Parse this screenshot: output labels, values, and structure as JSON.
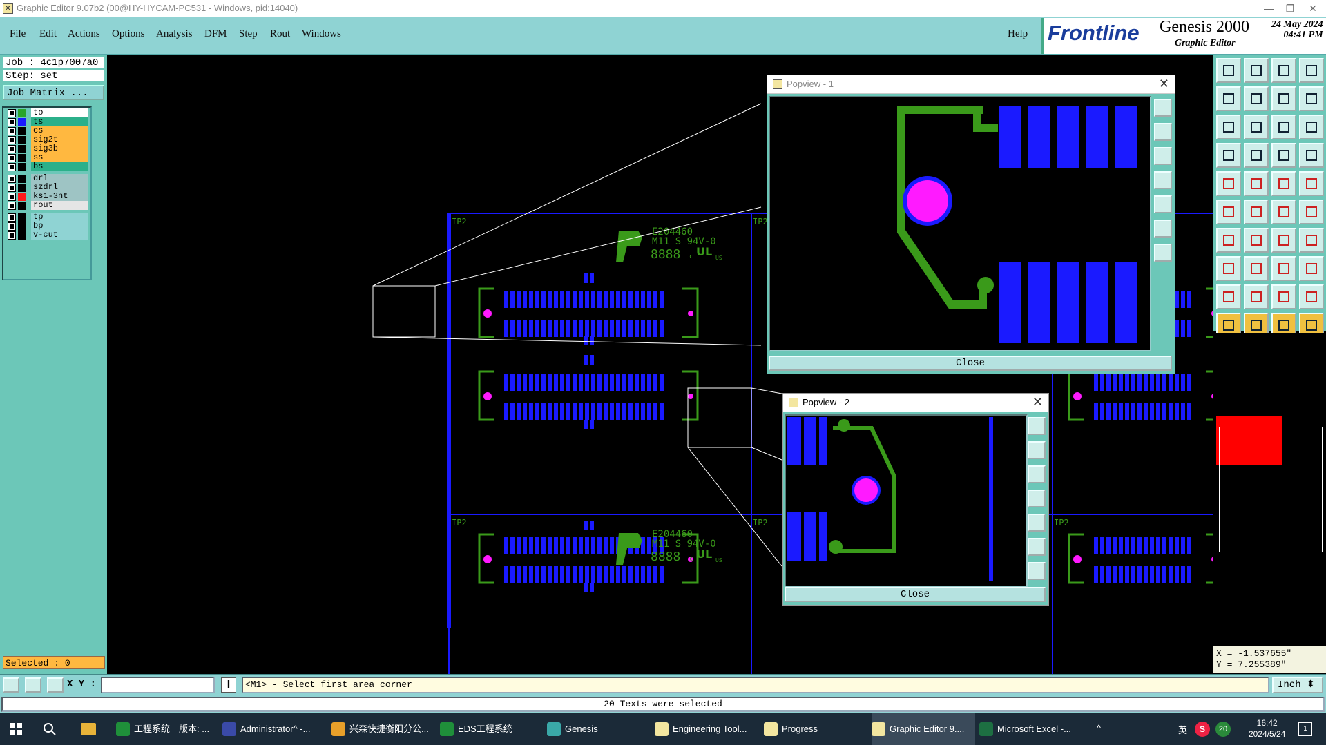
{
  "window": {
    "title": "Graphic Editor 9.07b2 (00@HY-HYCAM-PC531 - Windows, pid:14040)",
    "icon": "app-icon",
    "minimize": "—",
    "restore": "❐",
    "close": "✕"
  },
  "menu": {
    "items": [
      "File",
      "Edit",
      "Actions",
      "Options",
      "Analysis",
      "DFM",
      "Step",
      "Rout",
      "Windows"
    ],
    "help": "Help"
  },
  "branding": {
    "logo": "Frontline",
    "product": "Genesis 2000",
    "subtitle": "Graphic Editor",
    "date": "24 May 2024",
    "time": "04:41 PM"
  },
  "job": {
    "job_label": "Job : 4c1p7007a0",
    "step_label": "Step: set",
    "matrix_button": "Job Matrix ..."
  },
  "layers": [
    {
      "name": "to",
      "swatch": "#2aa52a",
      "bg": "#ffffff"
    },
    {
      "name": "ts",
      "swatch": "#1a1aff",
      "bg": "#2bb08a"
    },
    {
      "name": "cs",
      "swatch": "#000000",
      "bg": "#ffb840"
    },
    {
      "name": "sig2t",
      "swatch": "#000000",
      "bg": "#ffb840"
    },
    {
      "name": "sig3b",
      "swatch": "#000000",
      "bg": "#ffb840"
    },
    {
      "name": "ss",
      "swatch": "#000000",
      "bg": "#ffb840"
    },
    {
      "name": "bs",
      "swatch": "#000000",
      "bg": "#2bb08a"
    },
    {
      "name": "drl",
      "swatch": "#000000",
      "bg": "#9ec4c4"
    },
    {
      "name": "szdrl",
      "swatch": "#000000",
      "bg": "#9ec4c4"
    },
    {
      "name": "ks1-3nt",
      "swatch": "#ff1a1a",
      "bg": "#9ec4c4"
    },
    {
      "name": "rout",
      "swatch": "#000000",
      "bg": "#e5e5e5"
    },
    {
      "name": "tp",
      "swatch": "#000000",
      "bg": "#8fd3d3"
    },
    {
      "name": "bp",
      "swatch": "#000000",
      "bg": "#8fd3d3"
    },
    {
      "name": "v-cut",
      "swatch": "#000000",
      "bg": "#8fd3d3"
    }
  ],
  "selection": {
    "label": "Selected : 0"
  },
  "canvas_text": {
    "marking1": "E204460",
    "marking2": "M11 S 94V-0",
    "datecode": "8888",
    "ip_label": "IP2",
    "ul": "UL",
    "us": "US",
    "c": "c"
  },
  "popups": [
    {
      "title": "Popview - 1",
      "close_label": "Close"
    },
    {
      "title": "Popview - 2",
      "close_label": "Close"
    }
  ],
  "coords": {
    "x": "X = -1.537655\"",
    "y": "Y = 7.255389\""
  },
  "command": {
    "xy_label": "X Y :",
    "xy_value": "",
    "prompt": "<M1> - Select first area corner",
    "units": "Inch"
  },
  "status": {
    "message": "20 Texts were selected"
  },
  "colors": {
    "pad": "#1a1aff",
    "trace": "#3a9a1a",
    "hole": "#ff1aff",
    "outline": "#1a1aff",
    "selection_box": "#ffffff",
    "bg": "#000000"
  },
  "taskbar": {
    "items": [
      {
        "label": "工程系统　版本: ...",
        "icon": "green-f-icon"
      },
      {
        "label": "Administrator^ -...",
        "icon": "floppy-icon"
      },
      {
        "label": "兴森快捷衡阳分公...",
        "icon": "browser-icon"
      },
      {
        "label": "EDS工程系统",
        "icon": "green-f-icon"
      },
      {
        "label": "Genesis",
        "icon": "genesis-icon"
      },
      {
        "label": "Engineering Tool...",
        "icon": "app-icon"
      },
      {
        "label": "Progress",
        "icon": "app-icon"
      },
      {
        "label": "Graphic Editor 9....",
        "icon": "app-icon"
      },
      {
        "label": "Microsoft Excel -...",
        "icon": "excel-icon"
      }
    ],
    "tray_ime": "英",
    "tray_ime2": "英",
    "tray_badge": "20",
    "clock_time": "16:42",
    "clock_date": "2024/5/24",
    "notify_count": "1"
  }
}
